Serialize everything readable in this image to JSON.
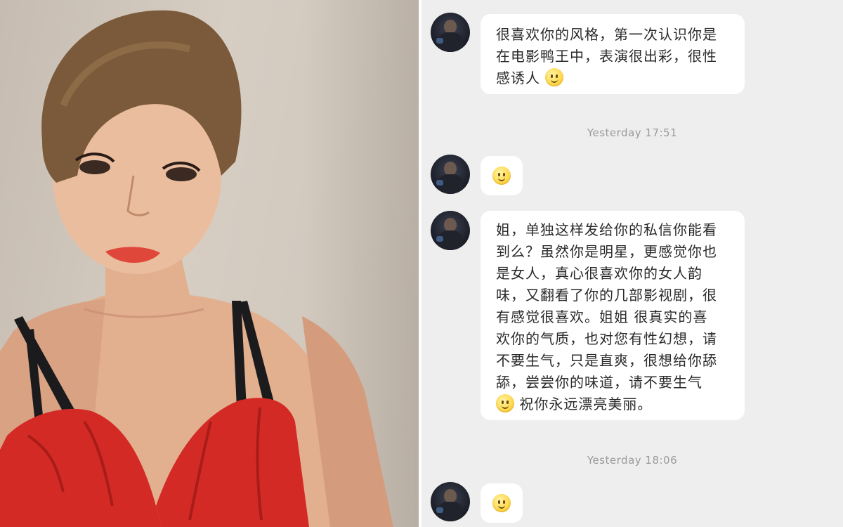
{
  "chat": {
    "messages": [
      {
        "sender_avatar": "user-avatar",
        "lines": [
          "很喜欢你的风格，第一次认识你是",
          "在电影鸭王中，表演很出彩，很性",
          "感诱人"
        ],
        "trailing_emoji": "smile-emoji"
      },
      {
        "type": "timestamp",
        "text": "Yesterday 17:51"
      },
      {
        "sender_avatar": "user-avatar",
        "emoji_only": "smile-emoji"
      },
      {
        "sender_avatar": "user-avatar",
        "lines": [
          "姐，单独这样发给你的私信你能看",
          "到么？虽然你是明星，更感觉你也",
          "是女人，真心很喜欢你的女人韵",
          "味，又翻看了你的几部影视剧，很",
          "有感觉很喜欢。姐姐 很真实的喜",
          "欢你的气质，也对您有性幻想，请",
          "不要生气，只是直爽，很想给你舔",
          "舔，尝尝你的味道，请不要生气",
          "祝你永远漂亮美丽。"
        ],
        "emoji_before_last_line": "smile-emoji"
      },
      {
        "type": "timestamp",
        "text": "Yesterday 18:06"
      },
      {
        "sender_avatar": "user-avatar",
        "emoji_only": "smile-emoji"
      }
    ]
  },
  "photo": {
    "description_icon": "woman-portrait-photo",
    "colors": {
      "dress": "#d42a25",
      "hair": "#7a5a3a",
      "skin": "#e9b99a",
      "wall": "#cfc6bb"
    }
  }
}
